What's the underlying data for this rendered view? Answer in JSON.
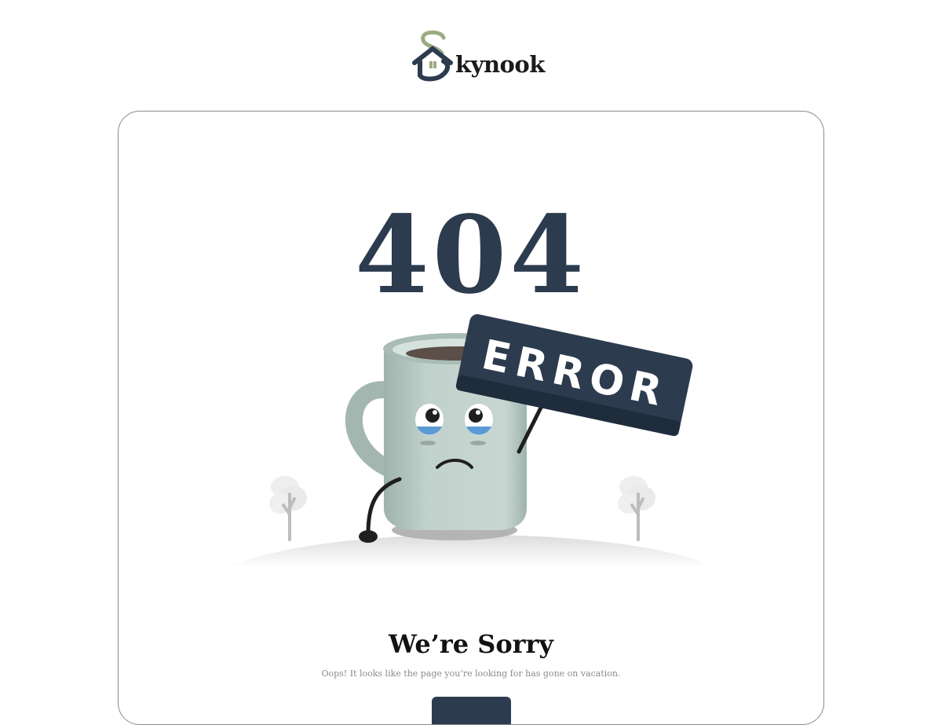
{
  "brand": {
    "name": "kynook",
    "logo_letter": "S",
    "colors": {
      "navy": "#2c3b4e",
      "sage": "#9aab84"
    }
  },
  "error": {
    "code": "404",
    "sign_text": "ERROR",
    "title": "We’re Sorry",
    "message": "Oops! It looks like the page you’re looking for has gone on vacation."
  },
  "button": {
    "label": ""
  },
  "icons": [
    "house-logo-icon",
    "mug-mascot-illustration",
    "tree-icon"
  ]
}
